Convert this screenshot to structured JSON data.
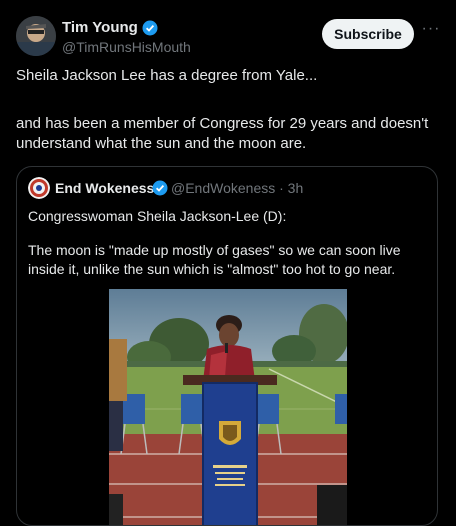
{
  "tweet": {
    "author_name": "Tim Young",
    "author_handle": "@TimRunsHisMouth",
    "subscribe_label": "Subscribe",
    "more_label": "···",
    "text_line1": "Sheila Jackson Lee has a degree from Yale...",
    "text_line2": "and has been a member of Congress for 29 years and doesn't understand what the sun and the moon are."
  },
  "quote": {
    "author_name": "End Wokeness",
    "handle_time": "@EndWokeness · 3h",
    "text_line1": "Congresswoman Sheila Jackson-Lee (D):",
    "text_line2": "The moon is \"made up mostly of gases\" so we can soon live inside it, unlike the sun which is \"almost\" too hot to go near."
  },
  "colors": {
    "background": "#000000",
    "text": "#e7e9ea",
    "secondary": "#71767b",
    "verified": "#1d9bf0",
    "border": "#2f3336"
  }
}
